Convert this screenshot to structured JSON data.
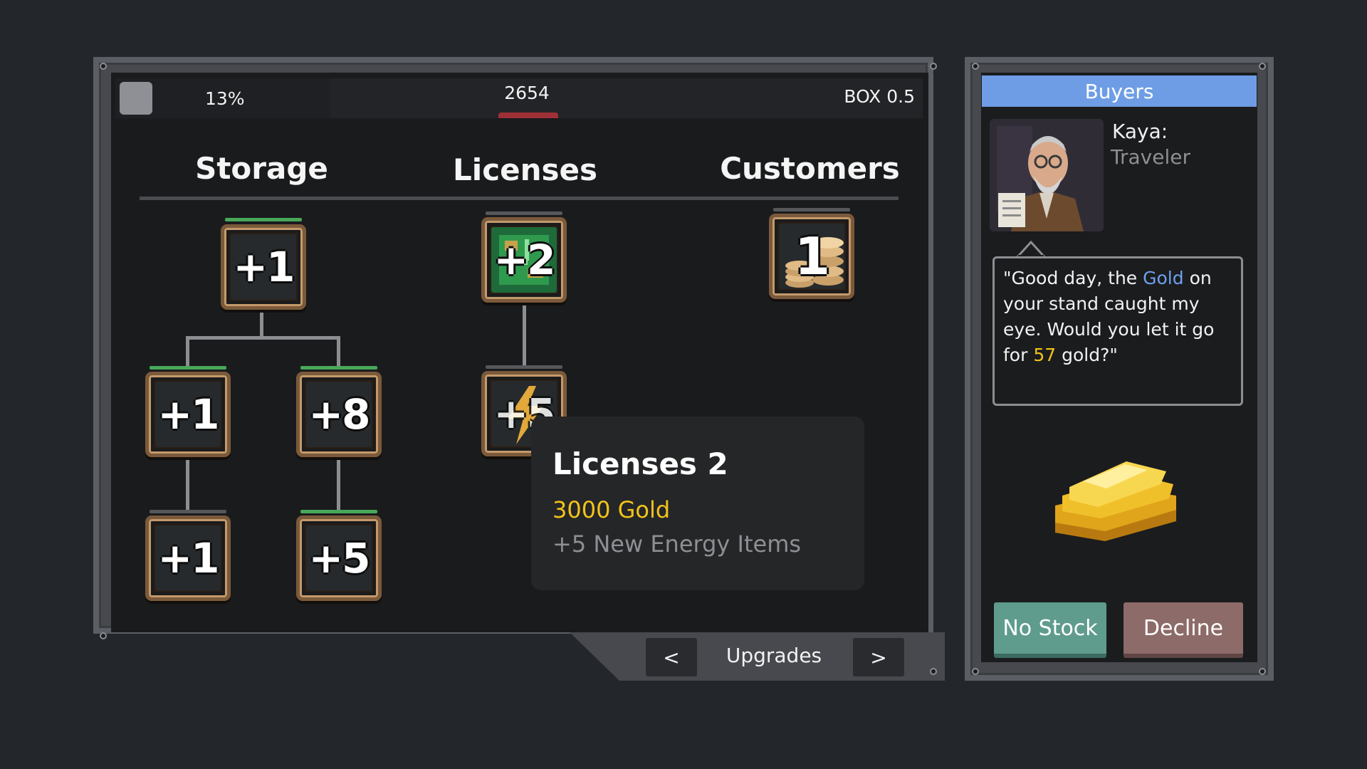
{
  "topbar": {
    "percent": "13%",
    "gold_amount": "2654",
    "box_label": "BOX 0.5"
  },
  "columns": {
    "storage": "Storage",
    "licenses": "Licenses",
    "customers": "Customers"
  },
  "upgrade_nodes": {
    "storage_top": "+1",
    "storage_mid_left": "+1",
    "storage_mid_right": "+8",
    "storage_bottom_left": "+1",
    "storage_bottom_right": "+5",
    "licenses_top": "+2",
    "licenses_second": "+5",
    "customers_top": "1"
  },
  "tooltip": {
    "title": "Licenses 2",
    "cost": "3000 Gold",
    "description": "+5 New Energy Items"
  },
  "nav": {
    "prev": "<",
    "label": "Upgrades",
    "next": ">"
  },
  "buyers": {
    "header": "Buyers",
    "name": "Kaya:",
    "role": "Traveler",
    "dialog": {
      "part1": "\"Good day, the ",
      "item": "Gold",
      "part2": " on your stand caught my eye. Would you let it go for ",
      "price": "57",
      "part3": " gold?\""
    },
    "no_stock_label": "No Stock",
    "decline_label": "Decline"
  },
  "colors": {
    "header_blue": "#6e9de6",
    "gold_text": "#f2c31a",
    "no_stock_button": "#5f9c8e",
    "decline_button": "#8d6b68",
    "node_cap_unlocked": "#47a85a"
  },
  "icons": {
    "licenses_top": "circuit-board-icon",
    "licenses_second": "lightning-bolt-icon",
    "customers_top": "coin-stack-icon",
    "buyer_item": "gold-bars-icon"
  }
}
